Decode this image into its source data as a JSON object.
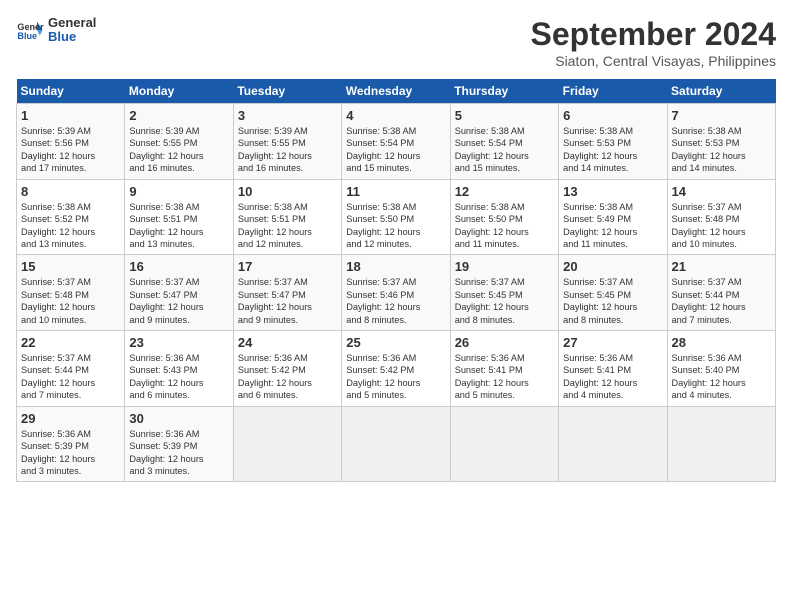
{
  "header": {
    "logo_line1": "General",
    "logo_line2": "Blue",
    "month": "September 2024",
    "location": "Siaton, Central Visayas, Philippines"
  },
  "weekdays": [
    "Sunday",
    "Monday",
    "Tuesday",
    "Wednesday",
    "Thursday",
    "Friday",
    "Saturday"
  ],
  "weeks": [
    [
      {
        "day": "1",
        "info": "Sunrise: 5:39 AM\nSunset: 5:56 PM\nDaylight: 12 hours\nand 17 minutes."
      },
      {
        "day": "2",
        "info": "Sunrise: 5:39 AM\nSunset: 5:55 PM\nDaylight: 12 hours\nand 16 minutes."
      },
      {
        "day": "3",
        "info": "Sunrise: 5:39 AM\nSunset: 5:55 PM\nDaylight: 12 hours\nand 16 minutes."
      },
      {
        "day": "4",
        "info": "Sunrise: 5:38 AM\nSunset: 5:54 PM\nDaylight: 12 hours\nand 15 minutes."
      },
      {
        "day": "5",
        "info": "Sunrise: 5:38 AM\nSunset: 5:54 PM\nDaylight: 12 hours\nand 15 minutes."
      },
      {
        "day": "6",
        "info": "Sunrise: 5:38 AM\nSunset: 5:53 PM\nDaylight: 12 hours\nand 14 minutes."
      },
      {
        "day": "7",
        "info": "Sunrise: 5:38 AM\nSunset: 5:53 PM\nDaylight: 12 hours\nand 14 minutes."
      }
    ],
    [
      {
        "day": "8",
        "info": "Sunrise: 5:38 AM\nSunset: 5:52 PM\nDaylight: 12 hours\nand 13 minutes."
      },
      {
        "day": "9",
        "info": "Sunrise: 5:38 AM\nSunset: 5:51 PM\nDaylight: 12 hours\nand 13 minutes."
      },
      {
        "day": "10",
        "info": "Sunrise: 5:38 AM\nSunset: 5:51 PM\nDaylight: 12 hours\nand 12 minutes."
      },
      {
        "day": "11",
        "info": "Sunrise: 5:38 AM\nSunset: 5:50 PM\nDaylight: 12 hours\nand 12 minutes."
      },
      {
        "day": "12",
        "info": "Sunrise: 5:38 AM\nSunset: 5:50 PM\nDaylight: 12 hours\nand 11 minutes."
      },
      {
        "day": "13",
        "info": "Sunrise: 5:38 AM\nSunset: 5:49 PM\nDaylight: 12 hours\nand 11 minutes."
      },
      {
        "day": "14",
        "info": "Sunrise: 5:37 AM\nSunset: 5:48 PM\nDaylight: 12 hours\nand 10 minutes."
      }
    ],
    [
      {
        "day": "15",
        "info": "Sunrise: 5:37 AM\nSunset: 5:48 PM\nDaylight: 12 hours\nand 10 minutes."
      },
      {
        "day": "16",
        "info": "Sunrise: 5:37 AM\nSunset: 5:47 PM\nDaylight: 12 hours\nand 9 minutes."
      },
      {
        "day": "17",
        "info": "Sunrise: 5:37 AM\nSunset: 5:47 PM\nDaylight: 12 hours\nand 9 minutes."
      },
      {
        "day": "18",
        "info": "Sunrise: 5:37 AM\nSunset: 5:46 PM\nDaylight: 12 hours\nand 8 minutes."
      },
      {
        "day": "19",
        "info": "Sunrise: 5:37 AM\nSunset: 5:45 PM\nDaylight: 12 hours\nand 8 minutes."
      },
      {
        "day": "20",
        "info": "Sunrise: 5:37 AM\nSunset: 5:45 PM\nDaylight: 12 hours\nand 8 minutes."
      },
      {
        "day": "21",
        "info": "Sunrise: 5:37 AM\nSunset: 5:44 PM\nDaylight: 12 hours\nand 7 minutes."
      }
    ],
    [
      {
        "day": "22",
        "info": "Sunrise: 5:37 AM\nSunset: 5:44 PM\nDaylight: 12 hours\nand 7 minutes."
      },
      {
        "day": "23",
        "info": "Sunrise: 5:36 AM\nSunset: 5:43 PM\nDaylight: 12 hours\nand 6 minutes."
      },
      {
        "day": "24",
        "info": "Sunrise: 5:36 AM\nSunset: 5:42 PM\nDaylight: 12 hours\nand 6 minutes."
      },
      {
        "day": "25",
        "info": "Sunrise: 5:36 AM\nSunset: 5:42 PM\nDaylight: 12 hours\nand 5 minutes."
      },
      {
        "day": "26",
        "info": "Sunrise: 5:36 AM\nSunset: 5:41 PM\nDaylight: 12 hours\nand 5 minutes."
      },
      {
        "day": "27",
        "info": "Sunrise: 5:36 AM\nSunset: 5:41 PM\nDaylight: 12 hours\nand 4 minutes."
      },
      {
        "day": "28",
        "info": "Sunrise: 5:36 AM\nSunset: 5:40 PM\nDaylight: 12 hours\nand 4 minutes."
      }
    ],
    [
      {
        "day": "29",
        "info": "Sunrise: 5:36 AM\nSunset: 5:39 PM\nDaylight: 12 hours\nand 3 minutes."
      },
      {
        "day": "30",
        "info": "Sunrise: 5:36 AM\nSunset: 5:39 PM\nDaylight: 12 hours\nand 3 minutes."
      },
      {
        "day": "",
        "info": ""
      },
      {
        "day": "",
        "info": ""
      },
      {
        "day": "",
        "info": ""
      },
      {
        "day": "",
        "info": ""
      },
      {
        "day": "",
        "info": ""
      }
    ]
  ]
}
